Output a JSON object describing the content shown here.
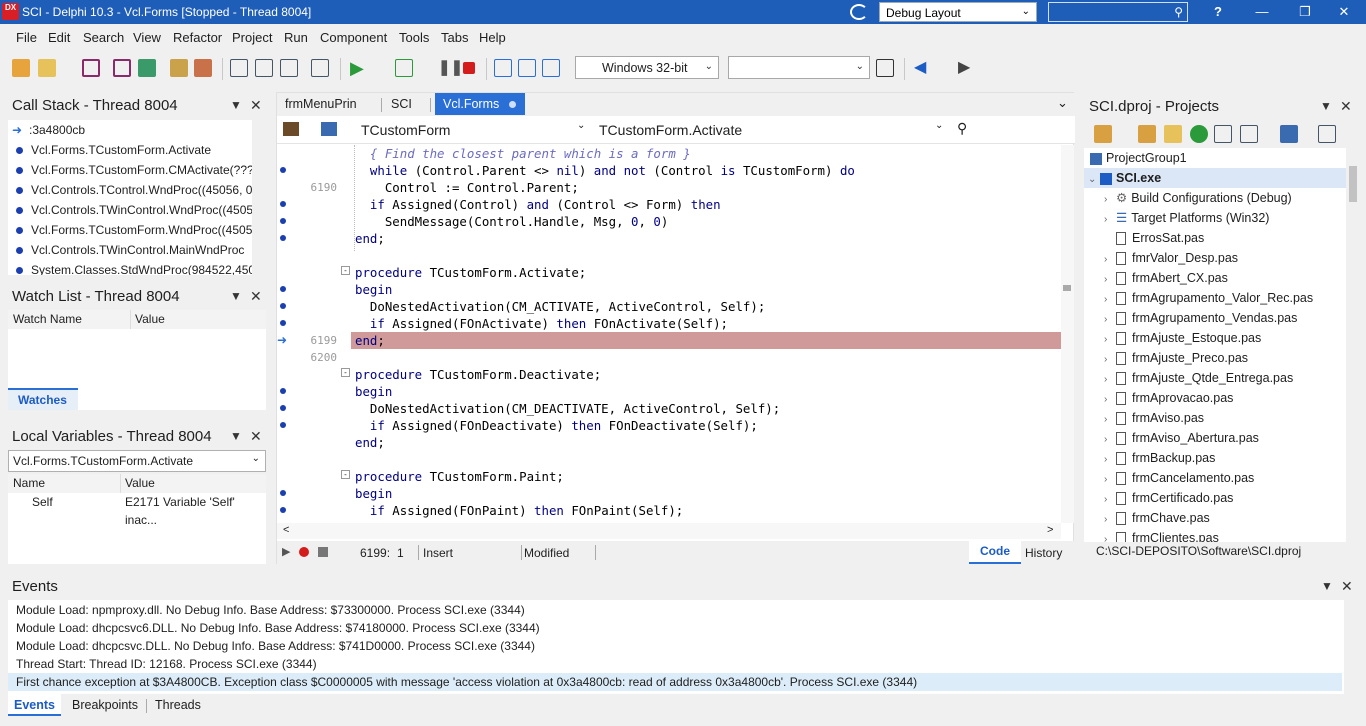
{
  "titlebar": {
    "app_title": "SCI - Delphi 10.3 - Vcl.Forms [Stopped - Thread 8004]",
    "logo": "DX",
    "layout_value": "Debug Layout",
    "help": "?"
  },
  "menu": [
    "File",
    "Edit",
    "Search",
    "View",
    "Refactor",
    "Project",
    "Run",
    "Component",
    "Tools",
    "Tabs",
    "Help"
  ],
  "toolbar": {
    "platform": "Windows 32-bit",
    "config": ""
  },
  "callstack": {
    "title": "Call Stack - Thread 8004",
    "items": [
      ":3a4800cb",
      "Vcl.Forms.TCustomForm.Activate",
      "Vcl.Forms.TCustomForm.CMActivate(???",
      "Vcl.Controls.TControl.WndProc((45056, 0",
      "Vcl.Controls.TWinControl.WndProc((4505",
      "Vcl.Forms.TCustomForm.WndProc((4505",
      "Vcl.Controls.TWinControl.MainWndProc",
      "System.Classes.StdWndProc(984522,4505"
    ]
  },
  "watchlist": {
    "title": "Watch List - Thread 8004",
    "col_name": "Watch Name",
    "col_value": "Value",
    "tab": "Watches"
  },
  "localvars": {
    "title": "Local Variables - Thread 8004",
    "context": "Vcl.Forms.TCustomForm.Activate",
    "col_name": "Name",
    "col_value": "Value",
    "rows": [
      {
        "name": "Self",
        "value": "E2171 Variable 'Self' inac..."
      }
    ]
  },
  "editor": {
    "tabs": [
      "frmMenuPrin",
      "SCI",
      "Vcl.Forms"
    ],
    "class_combo": "TCustomForm",
    "method_combo": "TCustomForm.Activate",
    "gutter": {
      "l2": "6190",
      "l11": "6199",
      "l12": "6200"
    },
    "status": {
      "position": "6199:",
      "col": "1",
      "mode": "Insert",
      "modified": "Modified",
      "code_tab": "Code",
      "history_tab": "History"
    }
  },
  "projects": {
    "title": "SCI.dproj - Projects",
    "group": "ProjectGroup1",
    "project": "SCI.exe",
    "items": [
      "Build Configurations (Debug)",
      "Target Platforms (Win32)",
      "ErrosSat.pas",
      "fmrValor_Desp.pas",
      "frmAbert_CX.pas",
      "frmAgrupamento_Valor_Rec.pas",
      "frmAgrupamento_Vendas.pas",
      "frmAjuste_Estoque.pas",
      "frmAjuste_Preco.pas",
      "frmAjuste_Qtde_Entrega.pas",
      "frmAprovacao.pas",
      "frmAviso.pas",
      "frmAviso_Abertura.pas",
      "frmBackup.pas",
      "frmCancelamento.pas",
      "frmCertificado.pas",
      "frmChave.pas",
      "frmClientes.pas"
    ],
    "path": "C:\\SCI-DEPOSITO\\Software\\SCI.dproj"
  },
  "events": {
    "title": "Events",
    "lines": [
      "Module Load: npmproxy.dll. No Debug Info. Base Address: $73300000. Process SCI.exe (3344)",
      "Module Load: dhcpcsvc6.DLL. No Debug Info. Base Address: $74180000. Process SCI.exe (3344)",
      "Module Load: dhcpcsvc.DLL. No Debug Info. Base Address: $741D0000. Process SCI.exe (3344)",
      "Thread Start: Thread ID: 12168. Process SCI.exe (3344)",
      "First chance exception at $3A4800CB. Exception class $C0000005 with message 'access violation at 0x3a4800cb: read of address 0x3a4800cb'. Process SCI.exe (3344)"
    ],
    "tabs": [
      "Events",
      "Breakpoints",
      "Threads"
    ]
  }
}
